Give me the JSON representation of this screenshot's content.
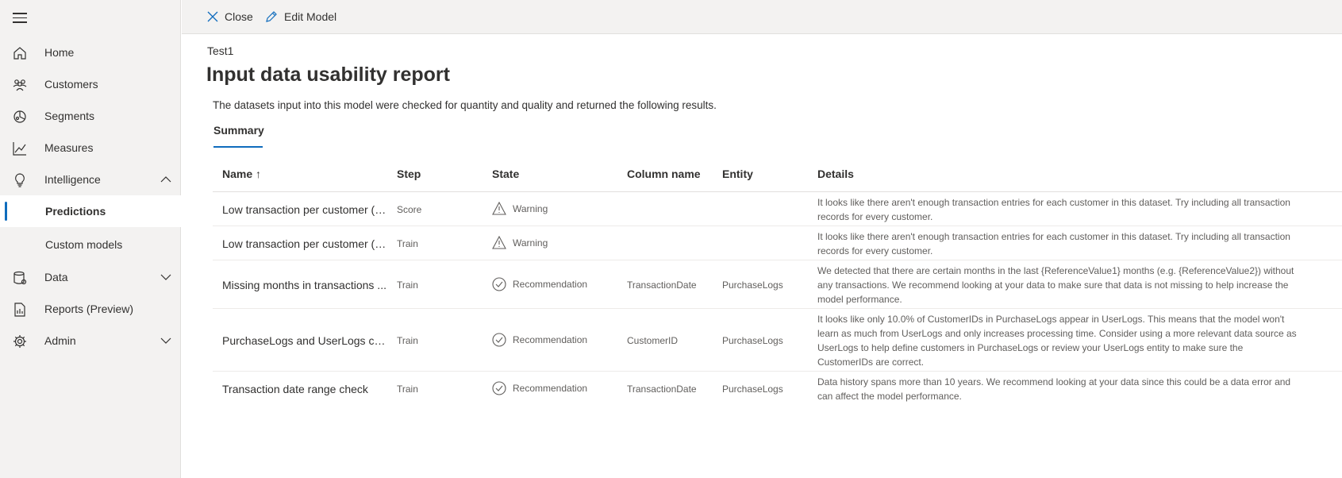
{
  "sidebar": {
    "items": [
      {
        "label": "Home",
        "icon": "home-icon"
      },
      {
        "label": "Customers",
        "icon": "customers-icon"
      },
      {
        "label": "Segments",
        "icon": "segments-icon"
      },
      {
        "label": "Measures",
        "icon": "measures-icon"
      },
      {
        "label": "Intelligence",
        "icon": "lightbulb-icon"
      },
      {
        "label": "Predictions"
      },
      {
        "label": "Custom models"
      },
      {
        "label": "Data",
        "icon": "database-icon"
      },
      {
        "label": "Reports (Preview)",
        "icon": "reports-icon"
      },
      {
        "label": "Admin",
        "icon": "gear-icon"
      }
    ]
  },
  "toolbar": {
    "close_label": "Close",
    "edit_label": "Edit Model"
  },
  "page": {
    "breadcrumb": "Test1",
    "title": "Input data usability report",
    "subtitle": "The datasets input into this model were checked for quantity and quality and returned the following results.",
    "tab": "Summary"
  },
  "table": {
    "headers": {
      "name": "Name ↑",
      "step": "Step",
      "state": "State",
      "column": "Column name",
      "entity": "Entity",
      "details": "Details"
    },
    "rows": [
      {
        "name": "Low transaction per customer (s...",
        "step": "Score",
        "state": "Warning",
        "state_icon": "warning-icon",
        "column": "",
        "entity": "",
        "details": "It looks like there aren't enough transaction entries for each customer in this dataset. Try including all transaction records for every customer."
      },
      {
        "name": "Low transaction per customer (s...",
        "step": "Train",
        "state": "Warning",
        "state_icon": "warning-icon",
        "column": "",
        "entity": "",
        "details": "It looks like there aren't enough transaction entries for each customer in this dataset. Try including all transaction records for every customer."
      },
      {
        "name": "Missing months in transactions ...",
        "step": "Train",
        "state": "Recommendation",
        "state_icon": "check-circle-icon",
        "column": "TransactionDate",
        "entity": "PurchaseLogs",
        "details": "We detected that there are certain months in the last {ReferenceValue1} months (e.g. {ReferenceValue2}) without any transactions. We recommend looking at your data to make sure that data is not missing to help increase the model performance."
      },
      {
        "name": "PurchaseLogs and UserLogs cus...",
        "step": "Train",
        "state": "Recommendation",
        "state_icon": "check-circle-icon",
        "column": "CustomerID",
        "entity": "PurchaseLogs",
        "details": "It looks like only 10.0% of CustomerIDs in PurchaseLogs appear in UserLogs. This means that the model won't learn as much from UserLogs and only increases processing time. Consider using a more relevant data source as UserLogs to help define customers in PurchaseLogs or review your UserLogs entity to make sure the CustomerIDs are correct."
      },
      {
        "name": "Transaction date range check",
        "step": "Train",
        "state": "Recommendation",
        "state_icon": "check-circle-icon",
        "column": "TransactionDate",
        "entity": "PurchaseLogs",
        "details": "Data history spans more than 10 years. We recommend looking at your data since this could be a data error and can affect the model performance."
      }
    ]
  }
}
